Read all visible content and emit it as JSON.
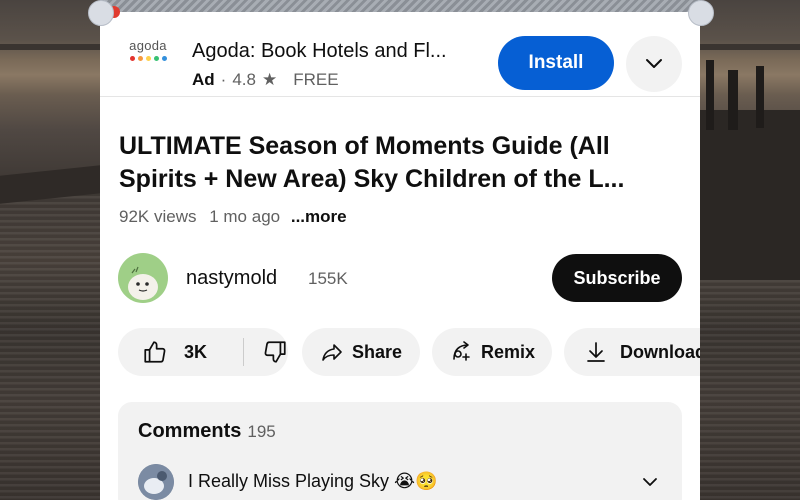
{
  "ad": {
    "app_name": "Agoda: Book Hotels and Fl...",
    "logo_word": "agoda",
    "logo_dot_colors": [
      "#e3342f",
      "#f6993f",
      "#ffd24d",
      "#38c172",
      "#3490dc"
    ],
    "tag": "Ad",
    "separator": "·",
    "rating": "4.8",
    "rating_icon": "★",
    "price": "FREE",
    "install_label": "Install",
    "expand_icon": "chevron-down-icon"
  },
  "video": {
    "title": "ULTIMATE Season of Moments Guide (All Spirits + New Area) Sky Children of the L...",
    "views": "92K views",
    "age": "1 mo ago",
    "more_label": "...more"
  },
  "channel": {
    "name": "nastymold",
    "subscribers": "155K",
    "subscribe_label": "Subscribe"
  },
  "actions": {
    "like_count": "3K",
    "share_label": "Share",
    "remix_label": "Remix",
    "download_label": "Download"
  },
  "comments": {
    "header": "Comments",
    "count": "195",
    "first_comment": "I Really Miss Playing Sky 😭🥺"
  },
  "colors": {
    "install_bg": "#065fd4",
    "subscribe_bg": "#0f0f0f",
    "chip_bg": "#f2f2f2",
    "avatar_bg": "#9fcf87"
  }
}
